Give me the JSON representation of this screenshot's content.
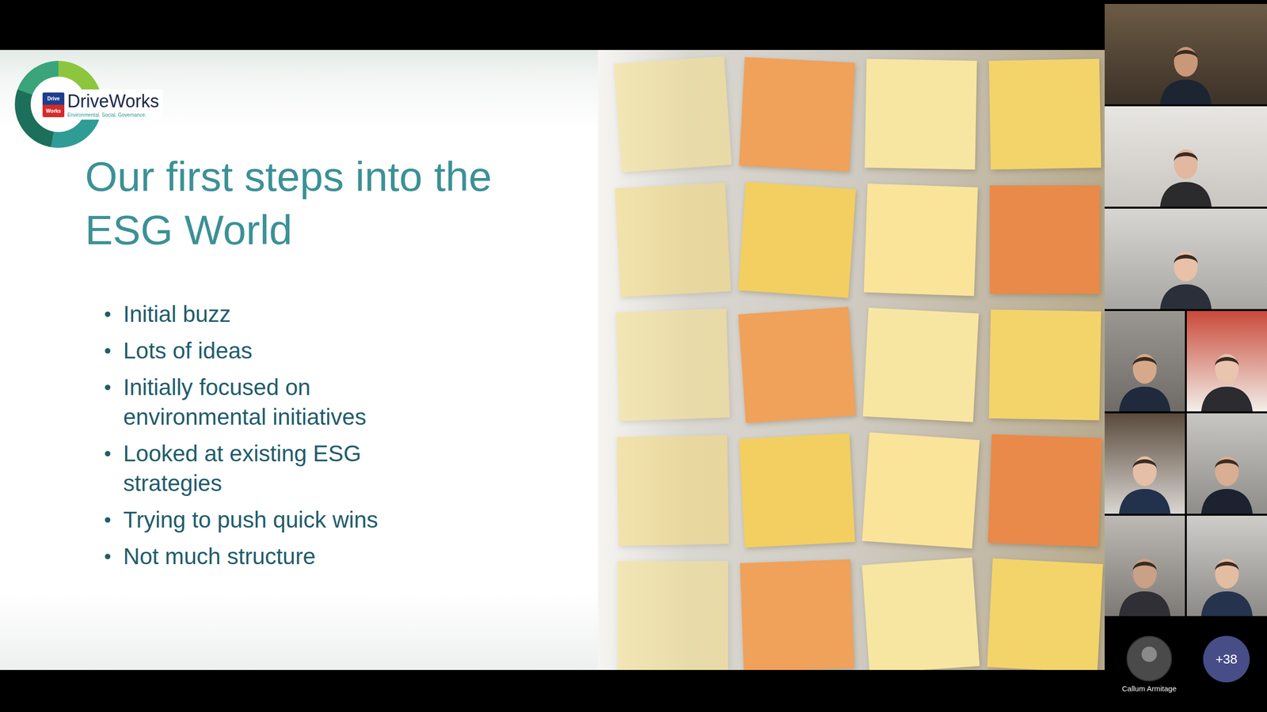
{
  "slide": {
    "logo": {
      "badge": [
        "Drive",
        "Works"
      ],
      "name": "DriveWorks",
      "tagline": "Environmental. Social. Governance."
    },
    "title": "Our first steps into the ESG World",
    "bullets": [
      "Initial buzz",
      "Lots of ideas",
      "Initially focused on environmental initiatives",
      "Looked at existing ESG strategies",
      "Trying to push quick wins",
      "Not much structure"
    ]
  },
  "participants": [
    {
      "kind": "wide"
    },
    {
      "kind": "wide"
    },
    {
      "kind": "wide"
    },
    {
      "kind": "half"
    },
    {
      "kind": "half"
    },
    {
      "kind": "half"
    },
    {
      "kind": "half"
    },
    {
      "kind": "half"
    },
    {
      "kind": "half"
    }
  ],
  "overflow": {
    "name": "Callum Armitage",
    "more": "+38"
  }
}
